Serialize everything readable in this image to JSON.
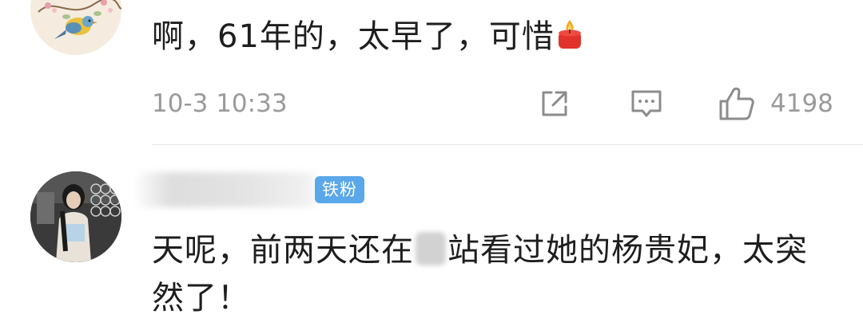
{
  "comments": [
    {
      "text": "啊，61年的，太早了，可惜",
      "emoji": "candle-icon",
      "time": "10-3 10:33",
      "like_count": "4198"
    },
    {
      "badge": "铁粉",
      "text_before": "天呢，前两天还在",
      "text_after": "站看过她的杨贵妃，太突然了！"
    }
  ],
  "colors": {
    "text": "#1e1e1e",
    "meta": "#9a9a9a",
    "badge_bg": "#5aa7e9",
    "divider": "#e8e8e8"
  }
}
